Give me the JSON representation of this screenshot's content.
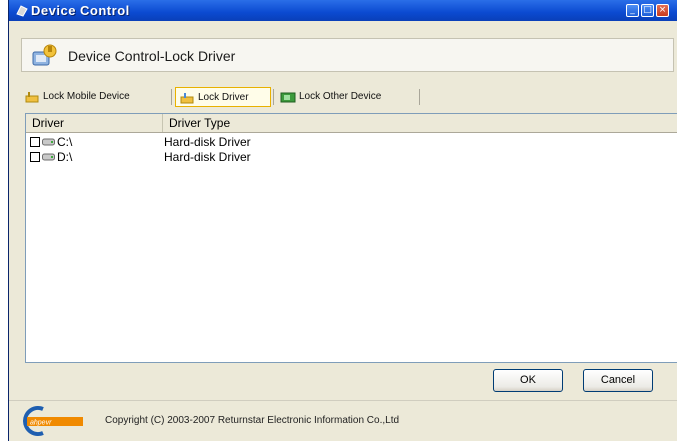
{
  "window": {
    "title": "Device Control",
    "header_title": "Device Control-Lock Driver"
  },
  "tabs": [
    {
      "label": "Lock Mobile Device",
      "icon": "mobile-device-icon",
      "active": false
    },
    {
      "label": "Lock Driver",
      "icon": "driver-icon",
      "active": true
    },
    {
      "label": "Lock Other Device",
      "icon": "other-device-icon",
      "active": false
    }
  ],
  "list": {
    "columns": [
      "Driver",
      "Driver Type"
    ],
    "rows": [
      {
        "driver": "C:\\",
        "type": "Hard-disk Driver",
        "checked": false
      },
      {
        "driver": "D:\\",
        "type": "Hard-disk Driver",
        "checked": false
      }
    ]
  },
  "buttons": {
    "ok": "OK",
    "cancel": "Cancel"
  },
  "footer": {
    "logo_text": "ahpevr",
    "copyright": "Copyright (C) 2003-2007 Returnstar Electronic Information Co.,Ltd"
  },
  "colors": {
    "titlebar": "#0b4ad1",
    "window_bg": "#ece9d8",
    "active_tab_border": "#e8b100",
    "logo_orange": "#f08a00",
    "logo_blue": "#1f5fb0"
  }
}
